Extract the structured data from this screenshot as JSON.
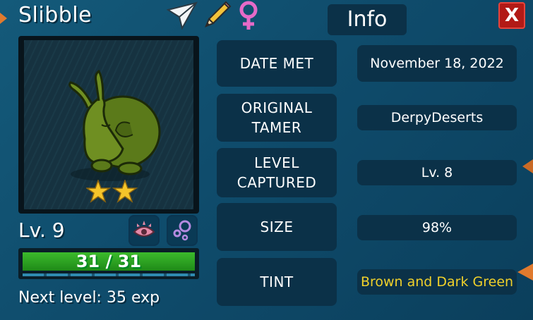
{
  "creature": {
    "name": "Slibble",
    "level": "Lv. 9",
    "hp": "31 / 31",
    "hp_fraction": 1.0,
    "next_level": "Next level: 35 exp",
    "stars": 2
  },
  "header_icons": [
    "paper-plane-icon",
    "pencil-icon",
    "female-symbol-icon"
  ],
  "info": {
    "title": "Info",
    "close_label": "X",
    "rows": [
      {
        "label": "DATE MET",
        "value": "November 18, 2022"
      },
      {
        "label": "ORIGINAL\nTAMER",
        "value": "DerpyDeserts"
      },
      {
        "label": "LEVEL\nCAPTURED",
        "value": "Lv. 8"
      },
      {
        "label": "SIZE",
        "value": "98%"
      },
      {
        "label": "TINT",
        "value": "Brown and Dark Green"
      }
    ]
  },
  "colors": {
    "panel_bg": "#0d4867",
    "box_bg": "#0b3148",
    "tint_text": "#f1d12a",
    "close_button": "#b21a16",
    "hp_bar": "#3cbb2c"
  }
}
